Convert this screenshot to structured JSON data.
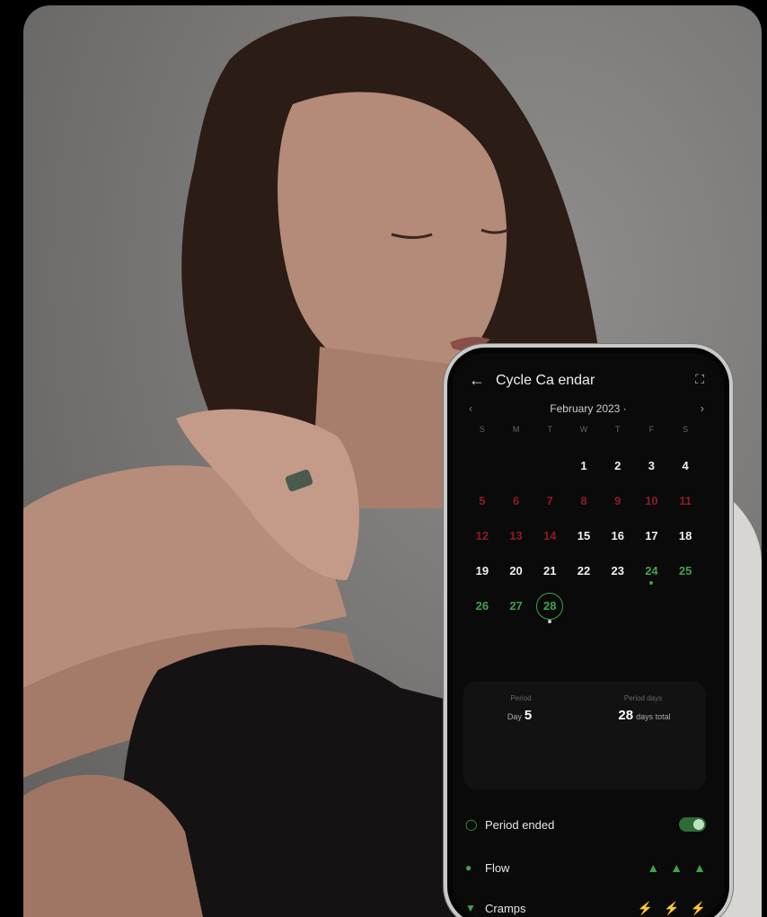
{
  "app": {
    "title": "Cycle Ca endar",
    "icons": {
      "back": "back-arrow-icon",
      "expand": "expand-icon",
      "prev": "chevron-left-icon",
      "next": "chevron-right-icon"
    }
  },
  "calendar": {
    "month_label": "February 2023 ·",
    "weekdays": [
      "S",
      "M",
      "T",
      "W",
      "T",
      "F",
      "S"
    ],
    "days": [
      {
        "label": "",
        "state": "empty"
      },
      {
        "label": "",
        "state": "empty"
      },
      {
        "label": "",
        "state": "empty"
      },
      {
        "label": "1",
        "state": "normal"
      },
      {
        "label": "2",
        "state": "normal"
      },
      {
        "label": "3",
        "state": "normal"
      },
      {
        "label": "4",
        "state": "normal"
      },
      {
        "label": "5",
        "state": "period"
      },
      {
        "label": "6",
        "state": "period"
      },
      {
        "label": "7",
        "state": "period"
      },
      {
        "label": "8",
        "state": "period"
      },
      {
        "label": "9",
        "state": "period"
      },
      {
        "label": "10",
        "state": "period"
      },
      {
        "label": "11",
        "state": "period"
      },
      {
        "label": "12",
        "state": "period"
      },
      {
        "label": "13",
        "state": "period"
      },
      {
        "label": "14",
        "state": "period"
      },
      {
        "label": "15",
        "state": "normal"
      },
      {
        "label": "16",
        "state": "normal"
      },
      {
        "label": "17",
        "state": "normal"
      },
      {
        "label": "18",
        "state": "normal"
      },
      {
        "label": "19",
        "state": "normal"
      },
      {
        "label": "20",
        "state": "normal"
      },
      {
        "label": "21",
        "state": "normal"
      },
      {
        "label": "22",
        "state": "normal"
      },
      {
        "label": "23",
        "state": "normal"
      },
      {
        "label": "24",
        "state": "fertile-dot"
      },
      {
        "label": "25",
        "state": "fertile"
      },
      {
        "label": "26",
        "state": "fertile"
      },
      {
        "label": "27",
        "state": "fertile"
      },
      {
        "label": "28",
        "state": "today"
      }
    ]
  },
  "stats": {
    "period_label": "Period",
    "period_prefix": "Day",
    "period_value": "5",
    "cycle_label": "Period days",
    "cycle_value": "28",
    "cycle_suffix": "days total"
  },
  "trackers": {
    "period_ended": {
      "label": "Period ended",
      "icon": "drop-outline-icon",
      "toggle_on": true
    },
    "flow": {
      "label": "Flow",
      "icon": "drop-icon",
      "level": 3,
      "max": 3
    },
    "cramps": {
      "label": "Cramps",
      "icon": "leaf-icon",
      "level": 2,
      "max": 3
    }
  },
  "colors": {
    "accent_green": "#3fa34d",
    "period_red": "#8b1c26",
    "background": "#0a0a0a"
  }
}
